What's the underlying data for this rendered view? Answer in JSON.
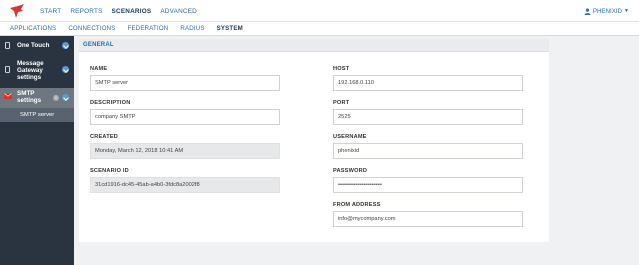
{
  "top_nav": {
    "items": [
      "START",
      "REPORTS",
      "SCENARIOS",
      "ADVANCED"
    ],
    "active_index": 2,
    "user": "PHENIXID"
  },
  "sub_nav": {
    "items": [
      "APPLICATIONS",
      "CONNECTIONS",
      "FEDERATION",
      "RADIUS",
      "SYSTEM"
    ],
    "active_index": 4
  },
  "sidebar": {
    "items": [
      {
        "label": "One Touch"
      },
      {
        "label": "Message Gateway settings"
      },
      {
        "label": "SMTP settings"
      }
    ],
    "active_sub": "SMTP server",
    "info_badge": "i"
  },
  "panel": {
    "section": "GENERAL",
    "fields": {
      "name": {
        "label": "NAME",
        "value": "SMTP server"
      },
      "description": {
        "label": "DESCRIPTION",
        "value": "company SMTP"
      },
      "created": {
        "label": "CREATED",
        "value": "Monday, March 12, 2018 10:41 AM"
      },
      "scenario_id": {
        "label": "SCENARIO ID",
        "value": "31cd1916-dc45-45ab-a4b0-3fdc8a2002f8"
      },
      "host": {
        "label": "HOST",
        "value": "192.168.0.110"
      },
      "port": {
        "label": "PORT",
        "value": "2525"
      },
      "username": {
        "label": "USERNAME",
        "value": "phenixid"
      },
      "password": {
        "label": "PASSWORD",
        "value": "••••••••••••••••••••••"
      },
      "from_address": {
        "label": "FROM ADDRESS",
        "value": "info@mycompany.com"
      }
    }
  },
  "colors": {
    "link": "#2c6bb0",
    "active_nav": "#1d3b63",
    "sidebar_bg": "#2a3440",
    "sidebar_active": "#6e7680",
    "accent_red": "#d9332b"
  }
}
